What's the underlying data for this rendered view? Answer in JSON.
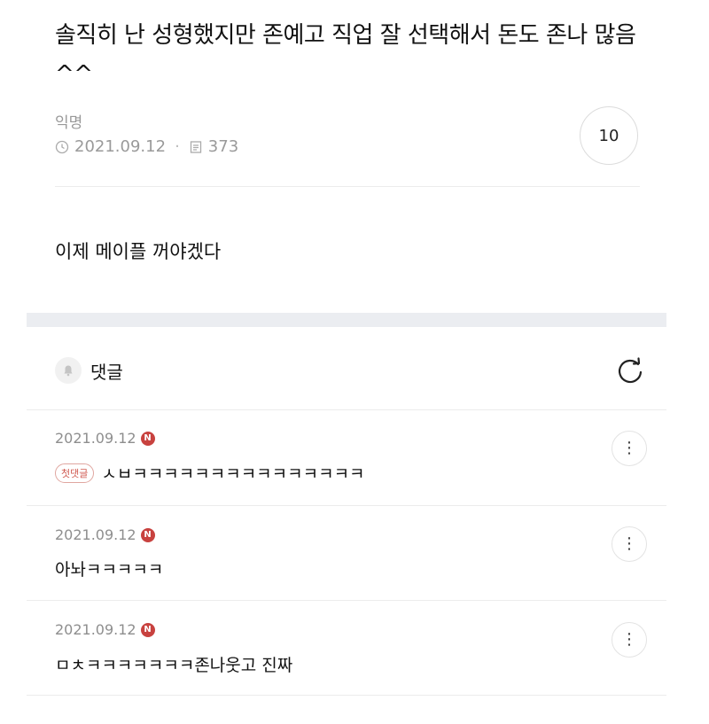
{
  "post": {
    "title": "솔직히 난 성형했지만 존예고 직업 잘 선택해서 돈도 존나 많음 ^^",
    "author": "익명",
    "date": "2021.09.12",
    "views": "373",
    "count": "10",
    "body": "이제 메이플 꺼야겠다"
  },
  "comments_section": {
    "label": "댓글"
  },
  "comments": [
    {
      "date": "2021.09.12",
      "badge": "N",
      "first_badge": "첫댓글",
      "text": "ㅅㅂㅋㅋㅋㅋㅋㅋㅋㅋㅋㅋㅋㅋㅋㅋㅋ"
    },
    {
      "date": "2021.09.12",
      "badge": "N",
      "text": "아놔ㅋㅋㅋㅋㅋ"
    },
    {
      "date": "2021.09.12",
      "badge": "N",
      "text": "ㅁㅊㅋㅋㅋㅋㅋㅋㅋ존나웃고 진짜"
    }
  ],
  "more_glyph": "⋮",
  "colors": {
    "new_badge": "#c8423f",
    "section_bar": "#ebedf1",
    "first_badge": "#d05a50"
  }
}
